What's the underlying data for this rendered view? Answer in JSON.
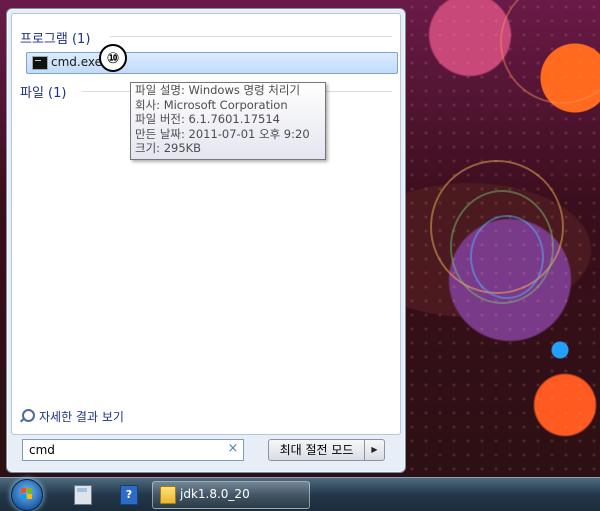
{
  "programs_section": {
    "header": "프로그램 (1)",
    "items": [
      {
        "label": "cmd.exe"
      }
    ]
  },
  "annotation": {
    "step": "⑩"
  },
  "files_section": {
    "header": "파일 (1)"
  },
  "tooltip": {
    "lines": [
      "파일 설명: Windows 명령 처리기",
      "회사: Microsoft Corporation",
      "파일 버전: 6.1.7601.17514",
      "만든 날짜: 2011-07-01 오후 9:20",
      "크기: 295KB"
    ]
  },
  "see_more": "자세한 결과 보기",
  "search": {
    "value": "cmd",
    "clear_glyph": "×"
  },
  "power": {
    "label": "최대 절전 모드",
    "arrow_glyph": "▶"
  },
  "taskbar": {
    "icons": [
      "start-orb-icon",
      "calculator-icon",
      "help-icon",
      "folder-icon"
    ],
    "buttons": [
      {
        "label": "jdk1.8.0_20"
      }
    ]
  }
}
